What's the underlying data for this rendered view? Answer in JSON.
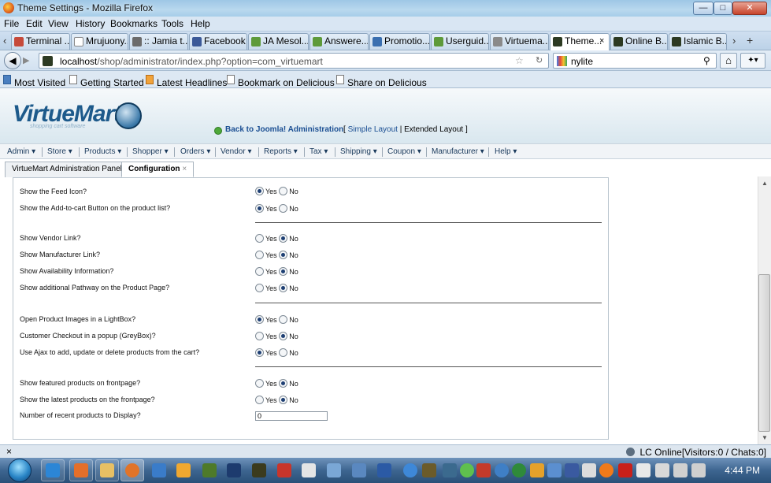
{
  "window": {
    "title": "Theme Settings - Mozilla Firefox"
  },
  "menu": [
    "File",
    "Edit",
    "View",
    "History",
    "Bookmarks",
    "Tools",
    "Help"
  ],
  "tabs": [
    {
      "label": "Terminal ...",
      "icon": "terminal-icon",
      "color": "#c64a3a"
    },
    {
      "label": "Mrujuony...",
      "icon": "page-icon",
      "color": "#ffffff"
    },
    {
      "label": ":: Jamia t...",
      "icon": "image-icon",
      "color": "#6b6b6b"
    },
    {
      "label": "Facebook",
      "icon": "facebook-icon",
      "color": "#3b5998"
    },
    {
      "label": "JA Mesol...",
      "icon": "joomla-icon",
      "color": "#5e9a3a"
    },
    {
      "label": "Answere...",
      "icon": "joomla-icon",
      "color": "#5e9a3a"
    },
    {
      "label": "Promotio...",
      "icon": "promo-icon",
      "color": "#3a6fb0"
    },
    {
      "label": "Userguid...",
      "icon": "joomla-icon",
      "color": "#5e9a3a"
    },
    {
      "label": "Virtuema...",
      "icon": "wrench-icon",
      "color": "#8a8a8a"
    },
    {
      "label": "Theme...",
      "icon": "virtuemart-icon",
      "color": "#2d3a22"
    },
    {
      "label": "Online B...",
      "icon": "virtuemart-icon",
      "color": "#2d3a22"
    },
    {
      "label": "Islamic B...",
      "icon": "virtuemart-icon",
      "color": "#2d3a22"
    }
  ],
  "tab_close": "×",
  "tab_scroll": "›",
  "new_tab": "+",
  "nav": {
    "url_host": "localhost",
    "url_path": "/shop/administrator/index.php?option=com_virtuemart",
    "search_value": "nylite"
  },
  "bookmarks": [
    "Most Visited",
    "Getting Started",
    "Latest Headlines",
    "Bookmark on Delicious",
    "Share on Delicious"
  ],
  "vm": {
    "logo": "VirtueMart",
    "logo_sub": "shopping cart software",
    "back_link": "Back to Joomla! Administration",
    "layout_open": "[",
    "simple_layout": "Simple Layout",
    "sep": "|",
    "extended_layout": "Extended Layout",
    "layout_close": "]",
    "menu": [
      "Admin",
      "Store",
      "Products",
      "Shopper",
      "Orders",
      "Vendor",
      "Reports",
      "Tax",
      "Shipping",
      "Coupon",
      "Manufacturer",
      "Help"
    ],
    "menu_arrow": "▾",
    "tabs": [
      "VirtueMart Administration Panel",
      "Configuration"
    ],
    "tab_close": "×"
  },
  "yes": "Yes",
  "no": "No",
  "settings": [
    {
      "label": "Show the Feed Icon?",
      "value": "Yes"
    },
    {
      "label": "Show the Add-to-cart Button on the product list?",
      "value": "Yes"
    },
    {
      "label": "Show Vendor Link?",
      "value": "No"
    },
    {
      "label": "Show Manufacturer Link?",
      "value": "No"
    },
    {
      "label": "Show Availability Information?",
      "value": "No"
    },
    {
      "label": "Show additional Pathway on the Product Page?",
      "value": "No"
    },
    {
      "label": "Open Product Images in a LightBox?",
      "value": "Yes"
    },
    {
      "label": "Customer Checkout in a popup (GreyBox)?",
      "value": "No"
    },
    {
      "label": "Use Ajax to add, update or delete products from the cart?",
      "value": "Yes"
    },
    {
      "label": "Show featured products on frontpage?",
      "value": "No"
    },
    {
      "label": "Show the latest products on the frontpage?",
      "value": "No"
    }
  ],
  "recent_count": {
    "label": "Number of recent products to Display?",
    "value": "0"
  },
  "status": {
    "text": "LC Online[Visitors:0 / Chats:0]",
    "close": "×"
  },
  "clock": "4:44 PM",
  "window_buttons": {
    "minimize": "—",
    "maximize": "□",
    "close": "✕"
  }
}
